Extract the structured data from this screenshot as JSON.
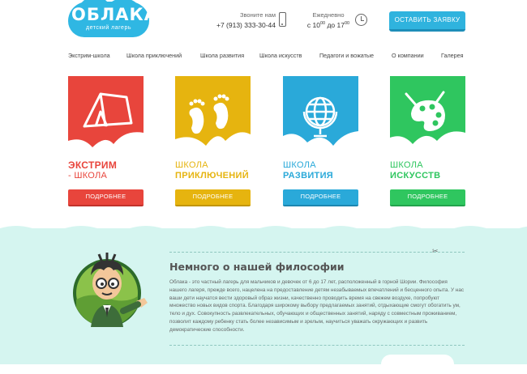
{
  "logo": {
    "title": "ОБЛАКА",
    "subtitle": "детский лагерь"
  },
  "contacts": {
    "phone_caption": "Звоните нам",
    "phone_number": "+7 (913) 333-30-44",
    "hours_caption": "Ежедневно",
    "hours_from_prefix": "с 10",
    "hours_from_sup": "00",
    "hours_mid": " до 17",
    "hours_to_sup": "00"
  },
  "order_button": "ОСТАВИТЬ ЗАЯВКУ",
  "nav": [
    "Экстрим-школа",
    "Школа приключений",
    "Школа развития",
    "Школа искусств",
    "Педагоги и вожатые",
    "О компании",
    "Галерея"
  ],
  "cards": [
    {
      "line1": "ЭКСТРИМ",
      "line2": "- ШКОЛА",
      "button": "ПОДРОБНЕЕ",
      "color": "#e8453c",
      "icon": "tent-icon"
    },
    {
      "line1": "ШКОЛА",
      "line2": "ПРИКЛЮЧЕНИЙ",
      "button": "ПОДРОБНЕЕ",
      "color": "#e6b40f",
      "icon": "footprints-icon"
    },
    {
      "line1": "ШКОЛА",
      "line2": "РАЗВИТИЯ",
      "button": "ПОДРОБНЕЕ",
      "color": "#2aa9d9",
      "icon": "globe-icon"
    },
    {
      "line1": "ШКОЛА",
      "line2": "ИСКУССТВ",
      "button": "ПОДРОБНЕЕ",
      "color": "#2fc65f",
      "icon": "palette-icon"
    }
  ],
  "philosophy": {
    "title": "Немного о нашей философии",
    "text": "Облака - это частный лагерь для мальчиков и девочек от 6 до 17 лет, расположенный в горной Шории. Философия нашего лагеря, прежде всего, нацелена на предоставление детям незабываемых впечатлений и бесценного опыта. У нас ваши дети научатся вести здоровый образ жизни, качественно проводить время на свежем воздухе, попробуют множество новых видов спорта. Благодаря широкому выбору предлагаемых занятий, отдыхающие смогут обогатить ум, тело и дух. Совокупность развлекательных, обучающих и общественных занятий, наряду с совместным проживанием, позволит каждому ребенку стать более независимым и зрелым, научиться уважать окружающих и развить демократические способности."
  },
  "colors": {
    "accent": "#2fb3de",
    "band": "#d5f5f0"
  }
}
